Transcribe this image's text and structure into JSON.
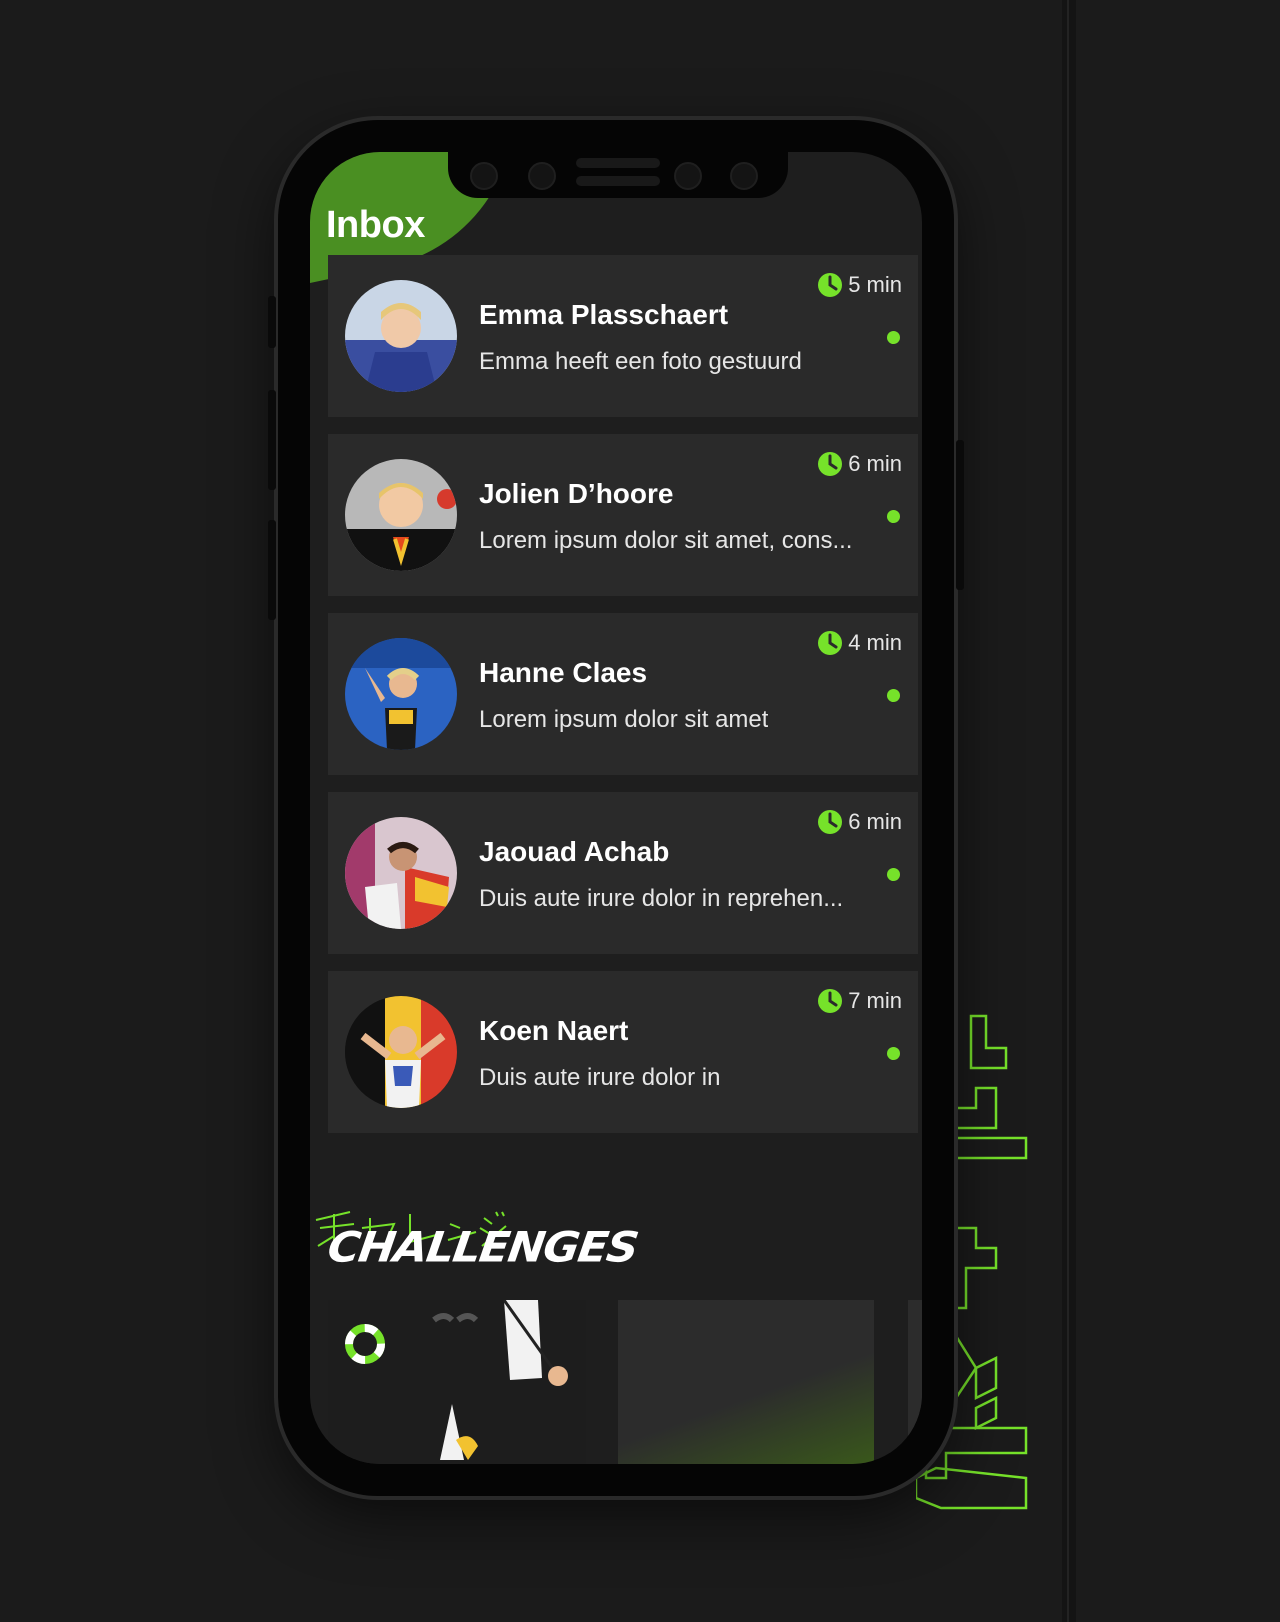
{
  "inbox": {
    "title": "Inbox",
    "messages": [
      {
        "name": "Emma Plasschaert",
        "preview": "Emma heeft een foto gestuurd",
        "time": "5 min",
        "unread": true
      },
      {
        "name": "Jolien D’hoore",
        "preview": "Lorem ipsum dolor sit amet, cons...",
        "time": "6 min",
        "unread": true
      },
      {
        "name": "Hanne Claes",
        "preview": "Lorem ipsum dolor sit amet",
        "time": "4 min",
        "unread": true
      },
      {
        "name": "Jaouad Achab",
        "preview": "Duis aute irure dolor in reprehen...",
        "time": "6 min",
        "unread": true
      },
      {
        "name": "Koen Naert",
        "preview": "Duis aute irure dolor in",
        "time": "7 min",
        "unread": true
      }
    ]
  },
  "challenges": {
    "title": "CHALLENGES",
    "katakana": "チャレンジ"
  },
  "icons": {
    "clock": "clock-icon",
    "unread": "unread-dot"
  },
  "colors": {
    "accent": "#76e22a",
    "background": "#1b1b1b",
    "card": "#2a2a2a",
    "screen": "#1e1e1e"
  }
}
